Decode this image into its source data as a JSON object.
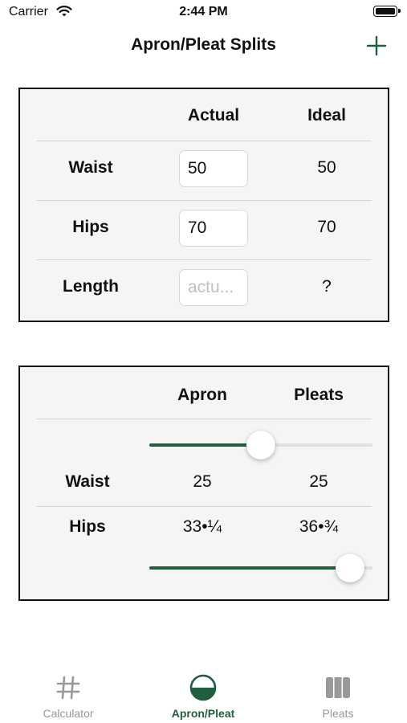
{
  "status_bar": {
    "carrier": "Carrier",
    "time": "2:44 PM"
  },
  "nav": {
    "title": "Apron/Pleat Splits",
    "add_icon": "plus-icon"
  },
  "measurements": {
    "col_actual": "Actual",
    "col_ideal": "Ideal",
    "rows": [
      {
        "label": "Waist",
        "actual_value": "50",
        "actual_placeholder": "",
        "ideal": "50"
      },
      {
        "label": "Hips",
        "actual_value": "70",
        "actual_placeholder": "",
        "ideal": "70"
      },
      {
        "label": "Length",
        "actual_value": "",
        "actual_placeholder": "actu...",
        "ideal": "?"
      }
    ]
  },
  "splits": {
    "col_apron": "Apron",
    "col_pleats": "Pleats",
    "waist": {
      "label": "Waist",
      "apron": "25",
      "pleats": "25"
    },
    "hips": {
      "label": "Hips",
      "apron": "33•¼",
      "pleats": "36•¾"
    },
    "waist_slider_fraction": 0.5,
    "hips_slider_fraction": 0.9
  },
  "tabs": [
    {
      "label": "Calculator",
      "icon": "hash-icon",
      "active": false
    },
    {
      "label": "Apron/Pleat",
      "icon": "half-circle-icon",
      "active": true
    },
    {
      "label": "Pleats",
      "icon": "columns-icon",
      "active": false
    }
  ],
  "colors": {
    "accent": "#215e40",
    "inactive_tab": "#999999",
    "card_bg": "#f5f5f5"
  }
}
